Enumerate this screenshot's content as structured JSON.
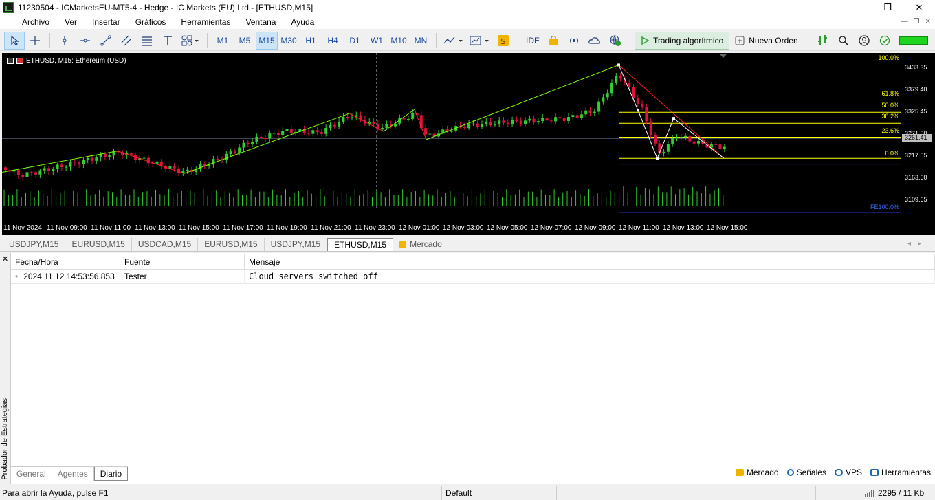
{
  "window": {
    "title": "11230504 - ICMarketsEU-MT5-4 - Hedge - IC Markets (EU) Ltd - [ETHUSD,M15]",
    "minimize": "—",
    "maximize": "❐",
    "close": "✕"
  },
  "menu": [
    "Archivo",
    "Ver",
    "Insertar",
    "Gráficos",
    "Herramientas",
    "Ventana",
    "Ayuda"
  ],
  "toolbar": {
    "timeframes": [
      "M1",
      "M5",
      "M15",
      "M30",
      "H1",
      "H4",
      "D1",
      "W1",
      "M10",
      "MN"
    ],
    "active_timeframe": "M15",
    "ide_label": "IDE",
    "algo_label": "Trading algorítmico",
    "new_order_label": "Nueva Orden"
  },
  "chart": {
    "label": "ETHUSD, M15:  Ethereum (USD)",
    "current_price_tag": "3261.41",
    "fib_levels": [
      "100.0%",
      "61.8%",
      "50.0%",
      "38.2%",
      "23.6%",
      "0.0%"
    ],
    "fe_label": "FE100.0%",
    "y_ticks": [
      "3433.35",
      "3379.40",
      "3325.45",
      "3271.50",
      "3217.55",
      "3163.60",
      "3109.65"
    ],
    "x_ticks": [
      "11 Nov 2024",
      "11 Nov 09:00",
      "11 Nov 11:00",
      "11 Nov 13:00",
      "11 Nov 15:00",
      "11 Nov 17:00",
      "11 Nov 19:00",
      "11 Nov 21:00",
      "11 Nov 23:00",
      "12 Nov 01:00",
      "12 Nov 03:00",
      "12 Nov 05:00",
      "12 Nov 07:00",
      "12 Nov 09:00",
      "12 Nov 11:00",
      "12 Nov 13:00",
      "12 Nov 15:00"
    ],
    "colors": {
      "bull": "#32cd32",
      "bear": "#dc143c",
      "background": "#000000",
      "fib": "#ffff00",
      "zigzag_up": "#7cfc00",
      "zigzag_down": "#ff2020"
    }
  },
  "chart_tabs": [
    "USDJPY,M15",
    "EURUSD,M15",
    "USDCAD,M15",
    "EURUSD,M15",
    "USDJPY,M15",
    "ETHUSD,M15",
    "Mercado"
  ],
  "active_chart_tab": "ETHUSD,M15",
  "toolbox": {
    "side_label": "Probador de Estrategias",
    "columns": [
      "Fecha/Hora",
      "Fuente",
      "Mensaje"
    ],
    "rows": [
      {
        "time": "2024.11.12 14:53:56.853",
        "source": "Tester",
        "message": "Cloud servers switched off"
      }
    ],
    "tabs": [
      "General",
      "Agentes",
      "Diario"
    ],
    "active_tab": "Diario",
    "links": [
      "Mercado",
      "Señales",
      "VPS",
      "Herramientas"
    ]
  },
  "status": {
    "help": "Para abrir la Ayuda, pulse F1",
    "profile": "Default",
    "traffic": "2295 / 11 Kb"
  }
}
